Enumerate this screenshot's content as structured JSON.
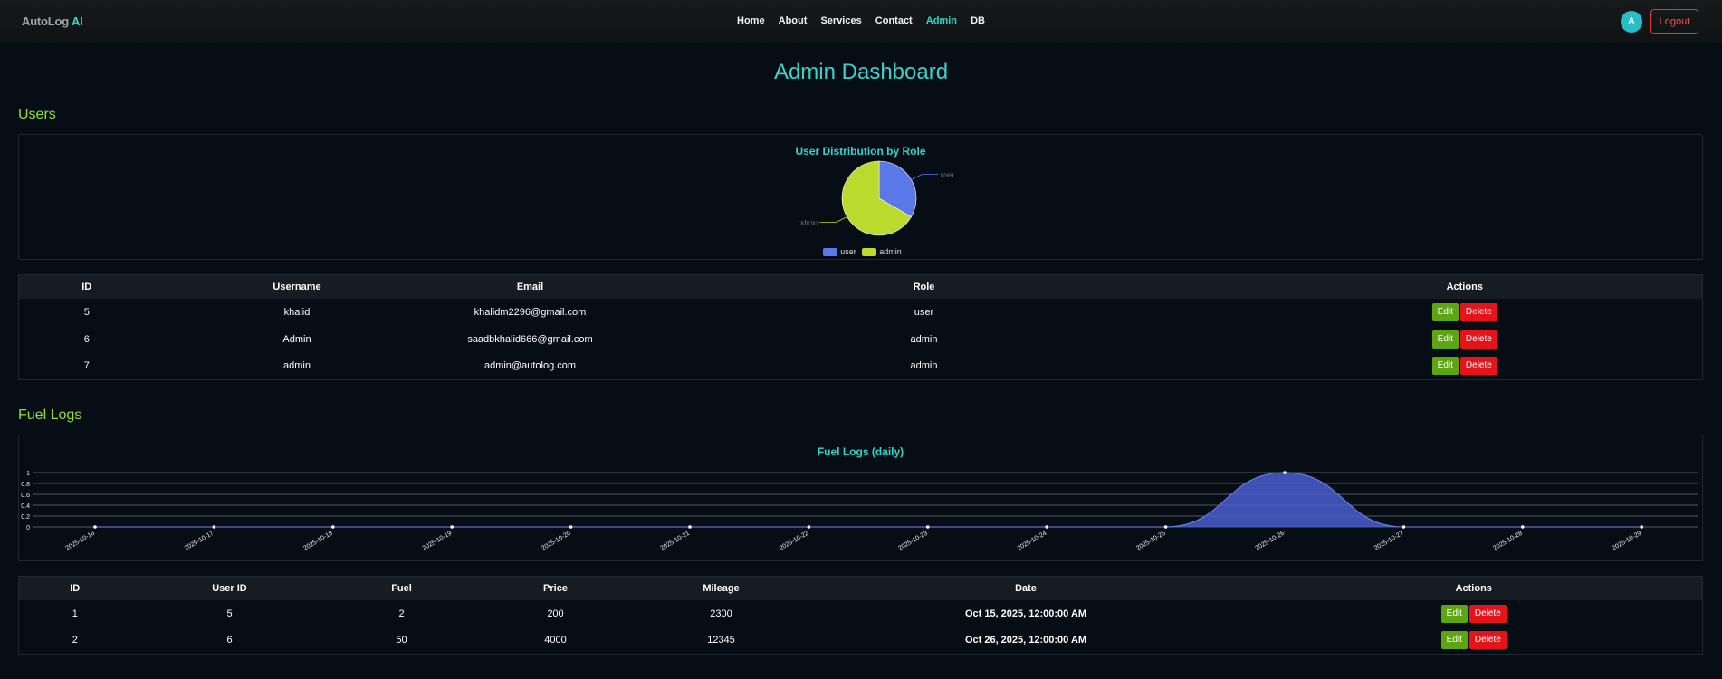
{
  "brand": {
    "part1": "AutoLog",
    "part2": "AI"
  },
  "nav": {
    "items": [
      "Home",
      "About",
      "Services",
      "Contact",
      "Admin",
      "DB"
    ],
    "active": "Admin"
  },
  "user": {
    "avatar_initial": "A",
    "logout_label": "Logout"
  },
  "page_title": "Admin Dashboard",
  "users_section": {
    "title": "Users",
    "chart_title": "User Distribution by Role",
    "table": {
      "headers": [
        "ID",
        "Username",
        "Email",
        "Role",
        "Actions"
      ],
      "rows": [
        {
          "id": "5",
          "username": "khalid",
          "email": "khalidm2296@gmail.com",
          "role": "user"
        },
        {
          "id": "6",
          "username": "Admin",
          "email": "saadbkhalid666@gmail.com",
          "role": "admin"
        },
        {
          "id": "7",
          "username": "admin",
          "email": "admin@autolog.com",
          "role": "admin"
        }
      ],
      "edit_label": "Edit",
      "delete_label": "Delete"
    }
  },
  "fuel_section": {
    "title": "Fuel Logs",
    "chart_title": "Fuel Logs (daily)",
    "table": {
      "headers": [
        "ID",
        "User ID",
        "Fuel",
        "Price",
        "Mileage",
        "Date",
        "Actions"
      ],
      "rows": [
        {
          "id": "1",
          "user_id": "5",
          "fuel": "2",
          "price": "200",
          "mileage": "2300",
          "date": "Oct 15, 2025, 12:00:00 AM"
        },
        {
          "id": "2",
          "user_id": "6",
          "fuel": "50",
          "price": "4000",
          "mileage": "12345",
          "date": "Oct 26, 2025, 12:00:00 AM"
        }
      ],
      "edit_label": "Edit",
      "delete_label": "Delete"
    }
  },
  "colors": {
    "accent": "#35d3c7",
    "section": "#8fe03a",
    "edit": "#5ea512",
    "delete": "#e4141a",
    "user_slice": "#5b78e8",
    "admin_slice": "#bcd92d",
    "area": "#4a5fcf"
  },
  "chart_data": [
    {
      "type": "pie",
      "title": "User Distribution by Role",
      "categories": [
        "user",
        "admin"
      ],
      "values": [
        1,
        2
      ],
      "legend": "bottom"
    },
    {
      "type": "area",
      "title": "Fuel Logs (daily)",
      "x": [
        "2025-10-16",
        "2025-10-17",
        "2025-10-18",
        "2025-10-19",
        "2025-10-20",
        "2025-10-21",
        "2025-10-22",
        "2025-10-23",
        "2025-10-24",
        "2025-10-25",
        "2025-10-26",
        "2025-10-27",
        "2025-10-28",
        "2025-10-29"
      ],
      "series": [
        {
          "values": [
            0,
            0,
            0,
            0,
            0,
            0,
            0,
            0,
            0,
            0,
            1,
            0,
            0,
            0
          ]
        }
      ],
      "yticks": [
        "0",
        "0.2",
        "0.4",
        "0.6",
        "0.8",
        "1"
      ],
      "ylim": [
        0,
        1
      ],
      "grid": true
    }
  ]
}
